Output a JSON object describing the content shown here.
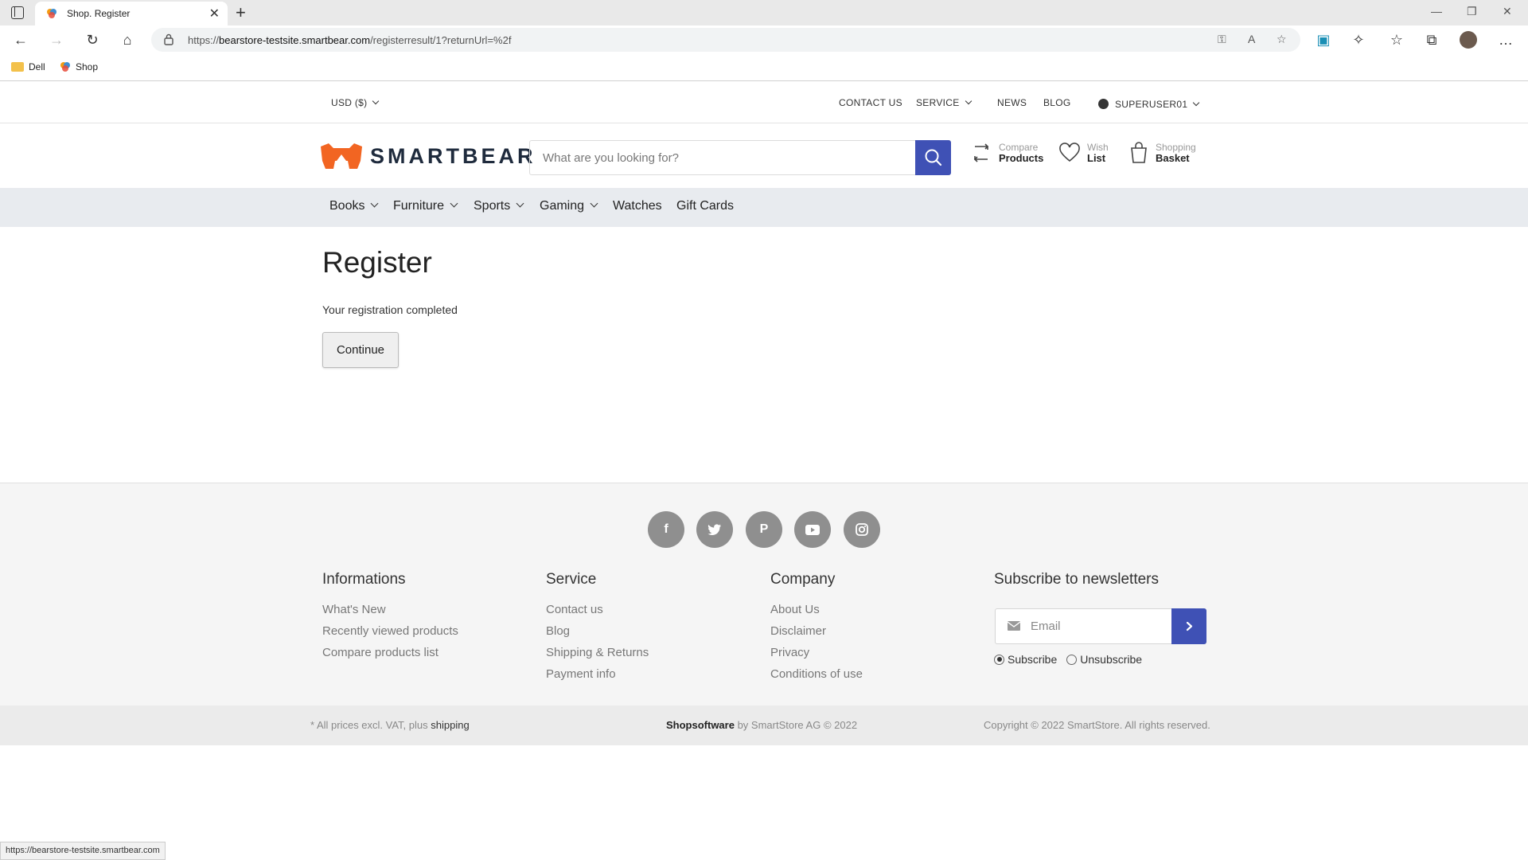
{
  "browser": {
    "tab_title": "Shop. Register",
    "url_prefix": "https://",
    "url_host": "bearstore-testsite.smartbear.com",
    "url_path": "/registerresult/1?returnUrl=%2f",
    "bookmarks": [
      "Dell",
      "Shop"
    ],
    "status_url": "https://bearstore-testsite.smartbear.com"
  },
  "topbar": {
    "currency": "USD  ($)",
    "contact": "CONTACT US",
    "service": "SERVICE",
    "news": "NEWS",
    "blog": "BLOG",
    "user": "SUPERUSER01"
  },
  "header": {
    "logo_text": "SMARTBEAR",
    "search_placeholder": "What are you looking for?",
    "compare_top": "Compare",
    "compare_bottom": "Products",
    "wish_top": "Wish",
    "wish_bottom": "List",
    "basket_top": "Shopping",
    "basket_bottom": "Basket"
  },
  "categories": [
    "Books",
    "Furniture",
    "Sports",
    "Gaming",
    "Watches",
    "Gift Cards"
  ],
  "content": {
    "title": "Register",
    "message": "Your registration completed",
    "continue_label": "Continue"
  },
  "footer": {
    "informations": {
      "title": "Informations",
      "links": [
        "What's New",
        "Recently viewed products",
        "Compare products list"
      ]
    },
    "service": {
      "title": "Service",
      "links": [
        "Contact us",
        "Blog",
        "Shipping & Returns",
        "Payment info"
      ]
    },
    "company": {
      "title": "Company",
      "links": [
        "About Us",
        "Disclaimer",
        "Privacy",
        "Conditions of use"
      ]
    },
    "newsletter": {
      "title": "Subscribe to newsletters",
      "email_placeholder": "Email",
      "subscribe": "Subscribe",
      "unsubscribe": "Unsubscribe"
    }
  },
  "bottombar": {
    "prices_note": "* All prices excl. VAT, plus",
    "shipping_link": "shipping",
    "brand": "Shopsoftware",
    "brand_rest": " by SmartStore AG © 2022",
    "copyright": "Copyright © 2022 SmartStore. All rights reserved."
  },
  "colors": {
    "accent": "#3f51b5",
    "logo_orange": "#f26522",
    "catnav_bg": "#e8ebef"
  }
}
